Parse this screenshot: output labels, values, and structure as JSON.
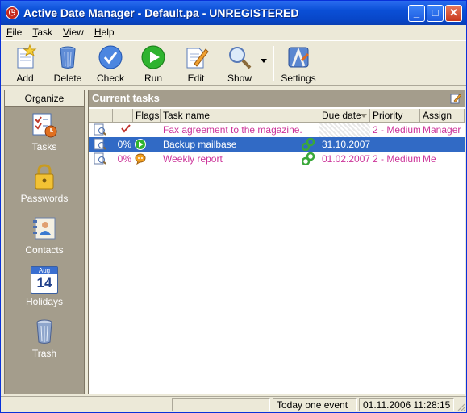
{
  "window": {
    "title": "Active Date Manager - Default.pa - UNREGISTERED",
    "min_glyph": "_",
    "max_glyph": "□",
    "close_glyph": "✕"
  },
  "menu": [
    "File",
    "Task",
    "View",
    "Help"
  ],
  "toolbar": {
    "add": "Add",
    "delete": "Delete",
    "check": "Check",
    "run": "Run",
    "edit": "Edit",
    "show": "Show",
    "settings": "Settings"
  },
  "sidebar": {
    "header": "Organize",
    "items": [
      {
        "label": "Tasks",
        "icon": "tasks-icon"
      },
      {
        "label": "Passwords",
        "icon": "padlock-icon"
      },
      {
        "label": "Contacts",
        "icon": "contacts-icon"
      },
      {
        "label": "Holidays",
        "icon": "calendar-icon"
      },
      {
        "label": "Trash",
        "icon": "trash-icon"
      }
    ],
    "calendar_month": "Aug",
    "calendar_day": "14"
  },
  "panel": {
    "title": "Current tasks",
    "columns": [
      "Flags",
      "Task name",
      "Due date",
      "Priority",
      "Assign"
    ],
    "rows": [
      {
        "percent": "",
        "task": "Fax agreement to the magazine.",
        "due": "",
        "priority": "2 - Medium",
        "assign": "Manager",
        "state": "done"
      },
      {
        "percent": "0%",
        "task": "Backup mailbase",
        "due": "31.10.2007",
        "priority": "",
        "assign": "",
        "state": "selected"
      },
      {
        "percent": "0%",
        "task": "Weekly report",
        "due": "01.02.2007",
        "priority": "2 - Medium",
        "assign": "Me",
        "state": "pink"
      }
    ]
  },
  "status": {
    "mode": "",
    "events": "Today one event",
    "datetime": "01.11.2006 11:28:15"
  },
  "colors": {
    "selection": "#316AC5",
    "pink": "#CC3399",
    "sidebar": "#A49D8C"
  }
}
